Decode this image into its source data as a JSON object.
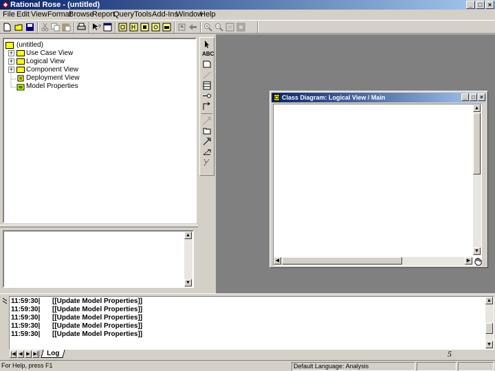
{
  "window": {
    "title": "Rational Rose - (untitled)"
  },
  "menu": [
    "File",
    "Edit",
    "View",
    "Format",
    "Browse",
    "Report",
    "Query",
    "Tools",
    "Add-Ins",
    "Window",
    "Help"
  ],
  "browser": {
    "root": "(untitled)",
    "items": [
      "Use Case View",
      "Logical View",
      "Component View",
      "Deployment View",
      "Model Properties"
    ]
  },
  "diagram": {
    "title": "Class Diagram: Logical View / Main"
  },
  "log": {
    "lines": [
      {
        "time": "11:59:30|",
        "msg": "[[Update Model Properties]]"
      },
      {
        "time": "11:59:30|",
        "msg": "[[Update Model Properties]]"
      },
      {
        "time": "11:59:30|",
        "msg": "[[Update Model Properties]]"
      },
      {
        "time": "11:59:30|",
        "msg": "[[Update Model Properties]]"
      },
      {
        "time": "11:59:30|",
        "msg": "[[Update Model Properties]]"
      }
    ],
    "tab": "Log",
    "page_number": "5"
  },
  "toolbox": {
    "text_tool_label": "ABC"
  },
  "status": {
    "help": "For Help, press F1",
    "language": "Default Language: Analysis"
  },
  "colors": {
    "title_start": "#0a246a",
    "title_end": "#a6caf0",
    "face": "#d4d0c8",
    "mdi": "#808080"
  }
}
